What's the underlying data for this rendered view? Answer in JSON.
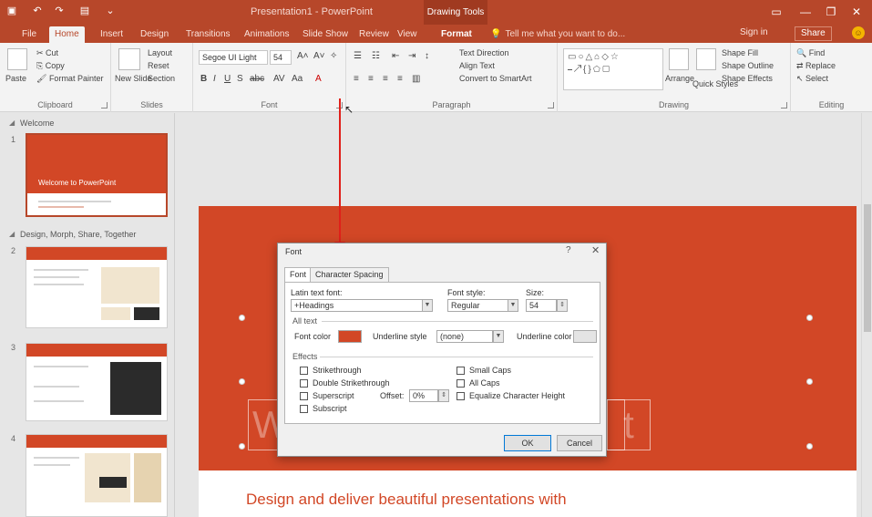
{
  "window": {
    "title": "Presentation1 - PowerPoint",
    "context_group": "Drawing Tools",
    "quick_access": [
      "save-icon",
      "undo-icon",
      "redo-icon",
      "present-icon"
    ],
    "controls": [
      "minimize",
      "restore",
      "close"
    ]
  },
  "tabs": [
    "File",
    "Home",
    "Insert",
    "Design",
    "Transitions",
    "Animations",
    "Slide Show",
    "Review",
    "View",
    "Format"
  ],
  "active_tab": "Home",
  "tellme": "Tell me what you want to do...",
  "signin": "Sign in",
  "share": "Share",
  "ribbon": {
    "clipboard": {
      "label": "Clipboard",
      "paste": "Paste",
      "cut": "Cut",
      "copy": "Copy",
      "format_painter": "Format Painter"
    },
    "slides": {
      "label": "Slides",
      "new_slide": "New Slide",
      "layout": "Layout",
      "reset": "Reset",
      "section": "Section"
    },
    "font": {
      "label": "Font",
      "font_name": "Segoe UI Light",
      "font_size": "54"
    },
    "paragraph": {
      "label": "Paragraph",
      "text_direction": "Text Direction",
      "align_text": "Align Text",
      "convert_smartart": "Convert to SmartArt"
    },
    "drawing": {
      "label": "Drawing",
      "arrange": "Arrange",
      "quick_styles": "Quick Styles",
      "shape_fill": "Shape Fill",
      "shape_outline": "Shape Outline",
      "shape_effects": "Shape Effects"
    },
    "editing": {
      "label": "Editing",
      "find": "Find",
      "replace": "Replace",
      "select": "Select"
    }
  },
  "slides_panel": {
    "sections": [
      "Welcome",
      "Design, Morph, Share, Together"
    ],
    "slide_numbers": [
      "1",
      "2",
      "3",
      "4"
    ],
    "first_slide_title": "Welcome to PowerPoint"
  },
  "main_slide": {
    "subtitle": "Design and deliver beautiful presentations with"
  },
  "dialog": {
    "title": "Font",
    "tabs": [
      "Font",
      "Character Spacing"
    ],
    "latin_font_label": "Latin text font:",
    "latin_font_value": "+Headings",
    "font_style_label": "Font style:",
    "font_style_value": "Regular",
    "size_label": "Size:",
    "size_value": "54",
    "all_text_label": "All text",
    "font_color_label": "Font color",
    "underline_style_label": "Underline style",
    "underline_style_value": "(none)",
    "underline_color_label": "Underline color",
    "effects_label": "Effects",
    "effects_left": [
      "Strikethrough",
      "Double Strikethrough",
      "Superscript",
      "Subscript"
    ],
    "offset_label": "Offset:",
    "offset_value": "0%",
    "effects_right": [
      "Small Caps",
      "All Caps",
      "Equalize Character Height"
    ],
    "ok": "OK",
    "cancel": "Cancel"
  }
}
